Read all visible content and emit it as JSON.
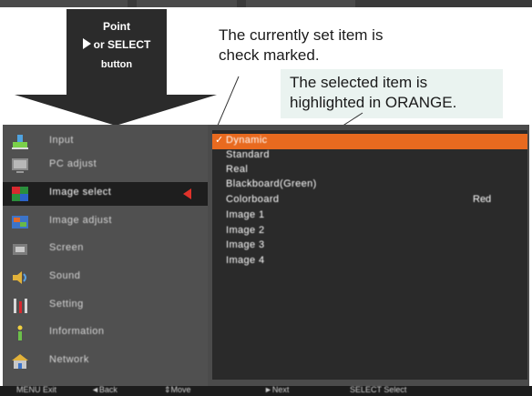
{
  "instruction": {
    "line1": "Point",
    "line2": "or SELECT",
    "line3": "button"
  },
  "callouts": {
    "check_note_line1": "The currently set item is",
    "check_note_line2": "check marked.",
    "orange_note_line1": "The selected item is",
    "orange_note_line2": "highlighted in ORANGE."
  },
  "sidebar": {
    "items": [
      {
        "label": "Input",
        "icon": "input-icon"
      },
      {
        "label": "PC adjust",
        "icon": "pc-adjust-icon"
      },
      {
        "label": "Image select",
        "icon": "image-select-icon"
      },
      {
        "label": "Image adjust",
        "icon": "image-adjust-icon"
      },
      {
        "label": "Screen",
        "icon": "screen-icon"
      },
      {
        "label": "Sound",
        "icon": "sound-icon"
      },
      {
        "label": "Setting",
        "icon": "setting-icon"
      },
      {
        "label": "Information",
        "icon": "information-icon"
      },
      {
        "label": "Network",
        "icon": "network-icon"
      }
    ],
    "active_index": 2
  },
  "panel": {
    "options": [
      {
        "label": "Dynamic",
        "checked": true,
        "highlighted": true
      },
      {
        "label": "Standard"
      },
      {
        "label": "Real"
      },
      {
        "label": "Blackboard(Green)"
      },
      {
        "label": "Colorboard",
        "value": "Red"
      },
      {
        "label": "Image 1"
      },
      {
        "label": "Image 2"
      },
      {
        "label": "Image 3"
      },
      {
        "label": "Image 4"
      }
    ]
  },
  "footer": {
    "menu": "MENU Exit",
    "back": "◄Back",
    "move": "⇕Move",
    "next": "►Next",
    "select": "SELECT Select"
  },
  "colors": {
    "highlight": "#e86a1f",
    "active_arrow": "#e0322a"
  }
}
